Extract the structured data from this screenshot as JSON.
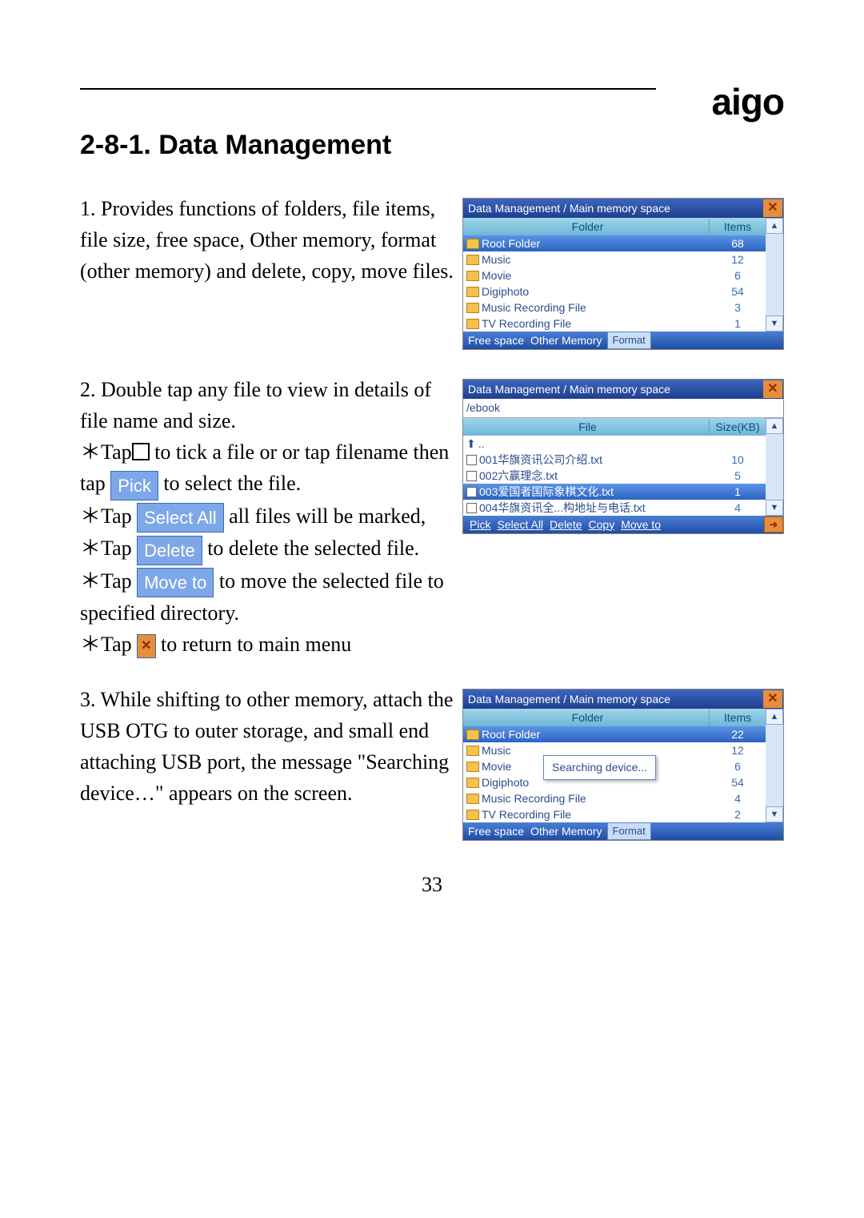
{
  "brand": "aigo",
  "heading": "2-8-1. Data Management",
  "page_number": "33",
  "para1": "1. Provides functions of folders, file items, file size, free space, Other memory, format (other memory) and delete, copy, move files.",
  "para2_intro": "2. Double tap any file to view in details of file name and size.",
  "para2_b1_a": "＊Tap",
  "para2_b1_b": " to tick a file or or tap filename then tap ",
  "para2_b1_c": " to select the file.",
  "para2_b2_a": "＊Tap ",
  "para2_b2_b": " all files will be marked,",
  "para2_b3_a": "＊Tap ",
  "para2_b3_b": " to delete the selected file.",
  "para2_b4_a": "＊Tap ",
  "para2_b4_b": " to move the selected file to specified directory.",
  "para2_b5_a": "＊Tap ",
  "para2_b5_b": " to return to main menu",
  "para3": "3. While shifting to other memory, attach the USB OTG to outer storage, and small end attaching USB port,  the message \"Searching device…\" appears on the screen.",
  "btn_pick": "Pick",
  "btn_select_all": "Select All",
  "btn_delete": "Delete",
  "btn_move_to": "Move to",
  "shot1": {
    "title": "Data Management / Main memory space",
    "head_a": "Folder",
    "head_b": "Items",
    "rows": [
      {
        "name": "Root Folder",
        "val": "68",
        "sel": true
      },
      {
        "name": "Music",
        "val": "12"
      },
      {
        "name": "Movie",
        "val": "6"
      },
      {
        "name": "Digiphoto",
        "val": "54"
      },
      {
        "name": "Music Recording File",
        "val": "3"
      },
      {
        "name": "TV Recording File",
        "val": "1"
      }
    ],
    "footer_a": "Free space",
    "footer_b": "Other Memory",
    "footer_c": "Format"
  },
  "shot2": {
    "title": "Data Management / Main memory space",
    "path": "/ebook",
    "head_a": "File",
    "head_b": "Size(KB)",
    "up": "..",
    "rows": [
      {
        "name": "001华旗资讯公司介绍.txt",
        "val": "10"
      },
      {
        "name": "002六赢理念.txt",
        "val": "5"
      },
      {
        "name": "003爱国者国际象棋文化.txt",
        "val": "1",
        "sel": true
      },
      {
        "name": "004华旗资讯全...构地址与电话.txt",
        "val": "4"
      }
    ],
    "toolbar": [
      "Pick",
      "Select All",
      "Delete",
      "Copy",
      "Move to"
    ]
  },
  "shot3": {
    "title": "Data Management / Main memory space",
    "head_a": "Folder",
    "head_b": "Items",
    "rows": [
      {
        "name": "Root Folder",
        "val": "22",
        "sel": true
      },
      {
        "name": "Music",
        "val": "12"
      },
      {
        "name": "Movie",
        "val": "6"
      },
      {
        "name": "Digiphoto",
        "val": "54"
      },
      {
        "name": "Music Recording File",
        "val": "4"
      },
      {
        "name": "TV Recording File",
        "val": "2"
      }
    ],
    "popup": "Searching device...",
    "footer_a": "Free space",
    "footer_b": "Other Memory",
    "footer_c": "Format"
  }
}
